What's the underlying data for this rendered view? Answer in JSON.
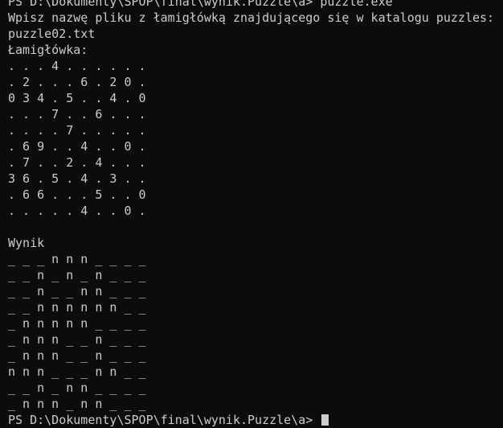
{
  "terminal": {
    "top_line": "PS D:\\Dokumenty\\SPOP\\final\\wynik.Puzzle\\a> puzzle.exe",
    "prompt_text": "Wpisz nazwę pliku z łamigłówką znajdującego się w katalogu puzzles:",
    "filename": "puzzle02.txt",
    "puzzle_label": "Łamigłówka:",
    "puzzle_rows": [
      ". . . 4 . . . . . .",
      ". 2 . . . 6 . 2 0 .",
      "0 3 4 . 5 . . 4 . 0",
      ". . . 7 . . 6 . . .",
      ". . . . 7 . . . . .",
      ". 6 9 . . 4 . . 0 .",
      ". 7 . . 2 . 4 . . .",
      "3 6 . 5 . 4 . 3 . .",
      ". 6 6 . . . 5 . . 0",
      ". . . . . 4 . . 0 ."
    ],
    "blank_line": "",
    "result_label": "Wynik",
    "result_rows": [
      "_ _ _ n n n _ _ _ _",
      "_ _ n _ n _ n _ _ _",
      "_ _ n _ _ n n _ _ _",
      "_ _ n n n n n n _ _",
      "_ n n n n n _ _ _ _",
      "_ n n n _ _ n _ _ _",
      "_ n n n _ _ n _ _ _",
      "n n n _ _ _ n n _ _",
      "_ _ n _ n n _ _ _ _",
      "_ n n n _ n n _ _ _"
    ],
    "final_prompt": "PS D:\\Dokumenty\\SPOP\\final\\wynik.Puzzle\\a> "
  }
}
